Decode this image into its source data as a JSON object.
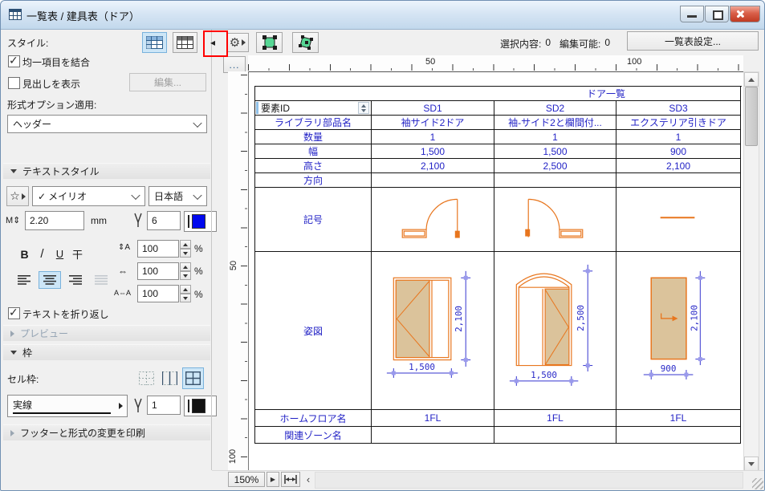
{
  "window": {
    "title": "一覧表 / 建具表（ドア）"
  },
  "toolbar": {
    "style_label": "スタイル:",
    "merge_checkbox": "均一項目を結合",
    "heading_checkbox": "見出しを表示",
    "edit_button": "編集...",
    "format_option_label": "形式オプション適用:",
    "format_option_value": "ヘッダー",
    "selection_label": "選択内容:",
    "selection_count": "0",
    "editable_label": "編集可能:",
    "editable_count": "0",
    "settings_button": "一覧表設定...",
    "overflow_button": "..."
  },
  "icons": {
    "collapse": "◂",
    "gear": "⚙",
    "star": "☆",
    "text_height": "M⇕",
    "line_spacing": "⇕A",
    "width_factor": "⇔",
    "char_spacing": "A⇔A",
    "scroll_left": "‹",
    "play": "▶"
  },
  "text_style": {
    "section_title": "テキストスタイル",
    "font_selected_mark": "✓",
    "font_name": "メイリオ",
    "language": "日本語",
    "size_value": "2.20",
    "size_unit": "mm",
    "pen_number": "6",
    "line_spacing": "100",
    "width_factor": "100",
    "char_spacing": "100",
    "percent": "%",
    "wrap_checkbox": "テキストを折り返し",
    "bold": "B",
    "italic": "/",
    "underline": "U",
    "strike": "干"
  },
  "sections": {
    "preview": "プレビュー",
    "frame": "枠",
    "cell_frame_label": "セル枠:",
    "line_type": "実線",
    "frame_pen_number": "1",
    "footer": "フッターと形式の変更を印刷"
  },
  "rulers": {
    "h50": "50",
    "h100": "100",
    "v50": "50",
    "v100": "100"
  },
  "statusbar": {
    "zoom": "150%"
  },
  "table": {
    "title": "ドア一覧",
    "id_label": "要素ID",
    "ids": [
      "SD1",
      "SD2",
      "SD3"
    ],
    "rows": [
      {
        "label": "ライブラリ部品名",
        "values": [
          "袖サイド2ドア",
          "袖-サイド2と欄間付...",
          "エクステリア引きドア"
        ]
      },
      {
        "label": "数量",
        "values": [
          "1",
          "1",
          "1"
        ]
      },
      {
        "label": "幅",
        "values": [
          "1,500",
          "1,500",
          "900"
        ]
      },
      {
        "label": "高さ",
        "values": [
          "2,100",
          "2,500",
          "2,100"
        ]
      },
      {
        "label": "方向",
        "values": [
          "",
          "",
          ""
        ]
      }
    ],
    "symbol_label": "記号",
    "elevation_label": "姿図",
    "floor_row": {
      "label": "ホームフロア名",
      "values": [
        "1FL",
        "1FL",
        "1FL"
      ]
    },
    "zone_row": {
      "label": "関連ゾーン名",
      "values": [
        "",
        "",
        ""
      ]
    },
    "dimensions": {
      "sd1": {
        "width": "1,500",
        "height": "2,100"
      },
      "sd2": {
        "width": "1,500",
        "height": "2,500"
      },
      "sd3": {
        "width": "900",
        "height": "2,100"
      }
    }
  },
  "colors": {
    "accent_blue": "#2323c6",
    "drawing_orange": "#e8761e",
    "door_fill": "#dbc39b",
    "dimension_blue": "#3535cf",
    "annotation_red": "#ff0000",
    "selection_green": "#56d794"
  }
}
